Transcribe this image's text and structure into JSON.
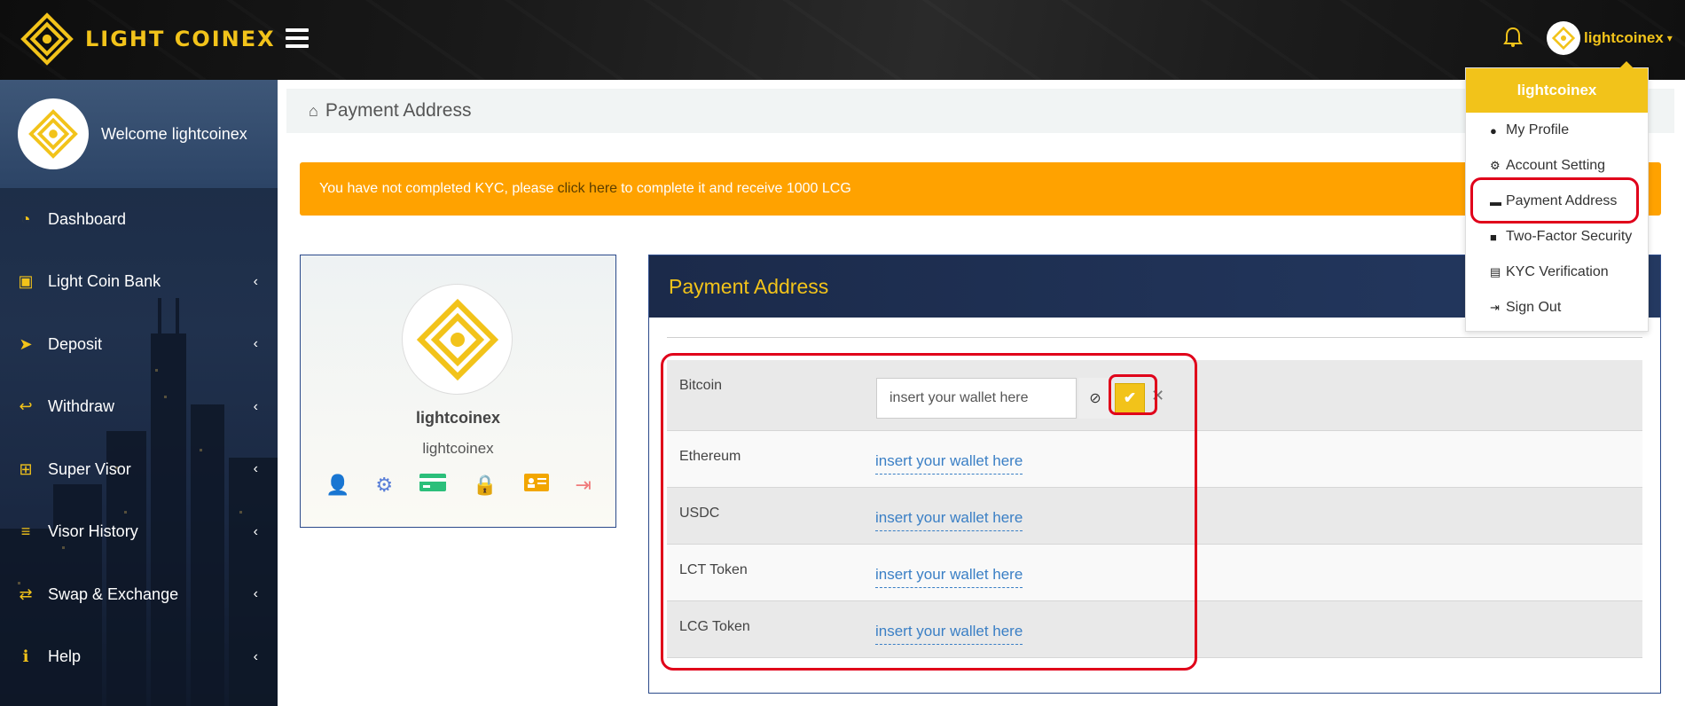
{
  "brand": {
    "name": "LIGHT COINEX"
  },
  "header": {
    "username": "lightcoinex"
  },
  "sidebar": {
    "welcome": "Welcome lightcoinex",
    "items": [
      {
        "label": "Dashboard",
        "icon": "dashboard-icon",
        "has_children": false
      },
      {
        "label": "Light Coin Bank",
        "icon": "money-icon",
        "has_children": true
      },
      {
        "label": "Deposit",
        "icon": "paper-plane-icon",
        "has_children": true
      },
      {
        "label": "Withdraw",
        "icon": "reply-icon",
        "has_children": true
      },
      {
        "label": "Super Visor",
        "icon": "sitemap-icon",
        "has_children": true
      },
      {
        "label": "Visor History",
        "icon": "list-icon",
        "has_children": true
      },
      {
        "label": "Swap & Exchange",
        "icon": "exchange-icon",
        "has_children": true
      },
      {
        "label": "Help",
        "icon": "info-icon",
        "has_children": true
      }
    ]
  },
  "breadcrumb": {
    "title": "Payment Address"
  },
  "kyc_alert": {
    "before": "You have not completed KYC, please",
    "link": "click here",
    "after": "to complete it and receive 1000 LCG"
  },
  "profile_card": {
    "name": "lightcoinex",
    "username": "lightcoinex"
  },
  "payment_panel": {
    "title": "Payment Address",
    "rows": [
      {
        "coin": "Bitcoin",
        "value": "insert your wallet here"
      },
      {
        "coin": "Ethereum",
        "value": "insert your wallet here"
      },
      {
        "coin": "USDC",
        "value": "insert your wallet here"
      },
      {
        "coin": "LCT Token",
        "value": "insert your wallet here"
      },
      {
        "coin": "LCG Token",
        "value": "insert your wallet here"
      }
    ]
  },
  "user_menu": {
    "header": "lightcoinex",
    "items": [
      {
        "label": "My Profile",
        "icon": "user-icon"
      },
      {
        "label": "Account Setting",
        "icon": "cogs-icon"
      },
      {
        "label": "Payment Address",
        "icon": "credit-card-icon"
      },
      {
        "label": "Two-Factor Security",
        "icon": "lock-icon"
      },
      {
        "label": "KYC Verification",
        "icon": "id-card-icon"
      },
      {
        "label": "Sign Out",
        "icon": "sign-out-icon"
      }
    ]
  },
  "colors": {
    "accent": "#f2c31a",
    "alert": "#ffa200",
    "highlight": "#e0001a",
    "link": "#3a7fc5"
  }
}
